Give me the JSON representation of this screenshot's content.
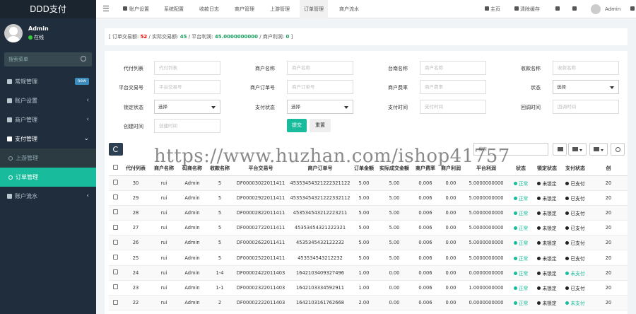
{
  "sidebar": {
    "brand": "DDD支付",
    "user": {
      "name": "Admin",
      "status": "在线"
    },
    "search_placeholder": "搜索菜单",
    "items": [
      {
        "label": "常规管理",
        "badge": "new"
      },
      {
        "label": "账户设置",
        "chevron": "‹"
      },
      {
        "label": "商户管理",
        "chevron": "‹"
      },
      {
        "label": "支付管理",
        "chevron": "⌄"
      }
    ],
    "subitems": [
      {
        "label": "上游管理"
      },
      {
        "label": "订单管理"
      }
    ],
    "last_item": {
      "label": "账户流水",
      "chevron": "‹"
    }
  },
  "topbar": {
    "tabs": [
      "账户设置",
      "系统配置",
      "收款日志",
      "商户管理",
      "上游管理",
      "订单管理",
      "商户流水"
    ],
    "active_tab": "订单管理",
    "right": {
      "home": "主页",
      "clear_cache": "清除缓存",
      "username": "Admin"
    }
  },
  "stats": {
    "prefix": "[ 订单交易额:",
    "total": "52",
    "actual_label": "/ 实际交易额:",
    "actual": "45",
    "platform_label": "/ 平台利润:",
    "platform": "45.0000000000",
    "merchant_label": "/ 商户利润:",
    "merchant": "0",
    "suffix": "]"
  },
  "filter": {
    "labels": [
      "代付列表",
      "商户名称",
      "台南名称",
      "收款名称",
      "平台交易号",
      "商户订单号",
      "商户费率",
      "状态",
      "锁定状态",
      "支付状态",
      "支付时间",
      "回调时间",
      "创建时间"
    ],
    "placeholders": [
      "代付列表",
      "商户名称",
      "商户名称",
      "收款名称",
      "平台交易号",
      "商户订单号",
      "商户费率",
      "支付时间",
      "回调时间",
      "创建时间"
    ],
    "select_value": "选择",
    "submit": "提交",
    "reset": "重置"
  },
  "table": {
    "search_placeholder": "搜索",
    "headers": [
      "",
      "代付列表",
      "商户名称",
      "码商名称",
      "收款名称",
      "平台交易号",
      "商户订单号",
      "订单金额",
      "实际成交金额",
      "商户费率",
      "商户利润",
      "平台利润",
      "状态",
      "锁定状态",
      "支付状态",
      "创"
    ],
    "rows": [
      [
        "30",
        "rui",
        "Admin",
        "5",
        "DF00003022011411",
        "45353454321222321122",
        "5.00",
        "5.00",
        "0.006",
        "0.00",
        "5.0000000000",
        "正常",
        "未锁定",
        "已支付",
        "20"
      ],
      [
        "29",
        "rui",
        "Admin",
        "5",
        "DF00002922011411",
        "45353454321222332112",
        "5.00",
        "5.00",
        "0.006",
        "0.00",
        "5.0000000000",
        "正常",
        "未锁定",
        "已支付",
        "20"
      ],
      [
        "28",
        "rui",
        "Admin",
        "5",
        "DF00002822011411",
        "453534543212223211",
        "5.00",
        "5.00",
        "0.006",
        "0.00",
        "5.0000000000",
        "正常",
        "未锁定",
        "已支付",
        "20"
      ],
      [
        "27",
        "rui",
        "Admin",
        "5",
        "DF00002722011411",
        "45353454321222321",
        "5.00",
        "5.00",
        "0.006",
        "0.00",
        "5.0000000000",
        "正常",
        "未锁定",
        "已支付",
        "20"
      ],
      [
        "26",
        "rui",
        "Admin",
        "5",
        "DF00002622011411",
        "4535345432122232",
        "5.00",
        "5.00",
        "0.006",
        "0.00",
        "5.0000000000",
        "正常",
        "未锁定",
        "已支付",
        "20"
      ],
      [
        "25",
        "rui",
        "Admin",
        "5",
        "DF00002522011411",
        "453534543212232",
        "5.00",
        "5.00",
        "0.006",
        "0.00",
        "5.0000000000",
        "正常",
        "未锁定",
        "已支付",
        "20"
      ],
      [
        "24",
        "rui",
        "Admin",
        "1-4",
        "DF00002422011403",
        "1642103409327496",
        "1.00",
        "0.00",
        "0.006",
        "0.00",
        "0.0000000000",
        "正常",
        "未锁定",
        "未支付",
        "20"
      ],
      [
        "23",
        "rui",
        "Admin",
        "1-1",
        "DF00002322011403",
        "1642103334592911",
        "1.00",
        "0.00",
        "0.006",
        "0.00",
        "1.0000000000",
        "正常",
        "未锁定",
        "已支付",
        "20"
      ],
      [
        "22",
        "rui",
        "Admin",
        "2",
        "DF00002222011403",
        "1642103161762668",
        "2.00",
        "0.00",
        "0.006",
        "0.00",
        "0.0000000000",
        "正常",
        "未锁定",
        "未支付",
        "20"
      ]
    ]
  },
  "watermark": "https://www.huzhan.com/ishop41757",
  "colors": {
    "accent": "#18bc9c",
    "sidebar": "#1f2d3d",
    "primary": "#2c3e50"
  }
}
